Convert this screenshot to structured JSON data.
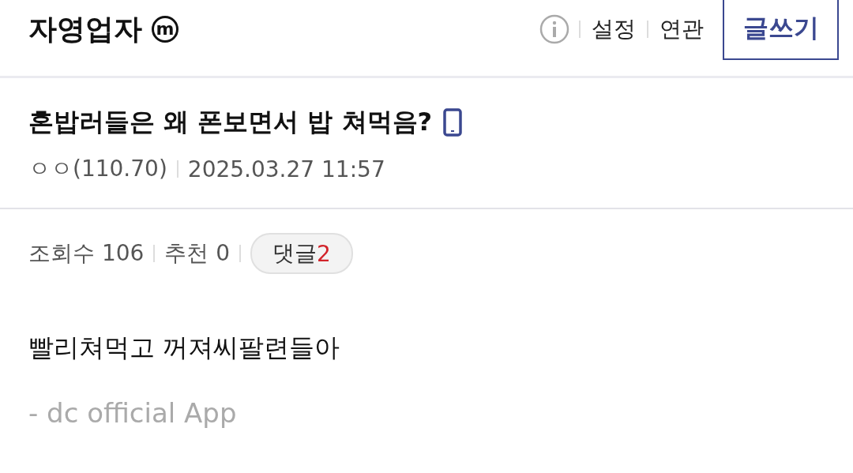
{
  "header": {
    "gallery_name": "자영업자",
    "badge": "m",
    "links": [
      "설정",
      "연관"
    ],
    "write_button": "글쓰기"
  },
  "post": {
    "title": "혼밥러들은 왜 폰보면서 밥 쳐먹음?",
    "author": "ㅇㅇ(110.70)",
    "date": "2025.03.27 11:57",
    "views": "조회수 106",
    "recommend": "추천 0",
    "comments_label": "댓글",
    "comments_count": "2",
    "body": "빨리쳐먹고 꺼져씨팔련들아",
    "signature": "- dc official App"
  }
}
